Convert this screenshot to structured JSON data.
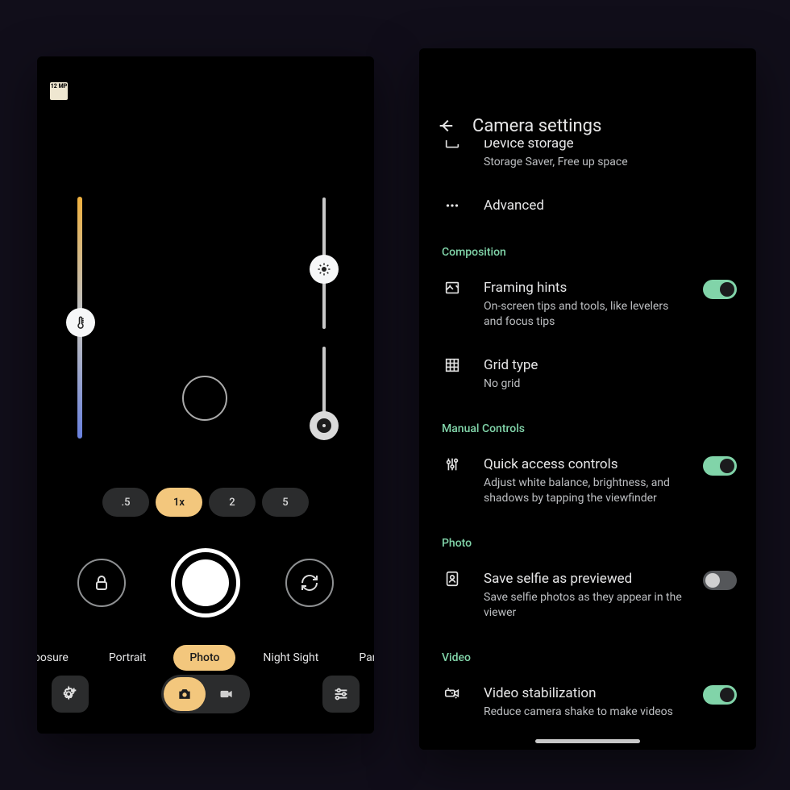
{
  "camera": {
    "res_badge": "12\nMP",
    "zoom": [
      ".5",
      "1x",
      "2",
      "5"
    ],
    "zoom_active": 1,
    "modes": [
      "g Exposure",
      "Portrait",
      "Photo",
      "Night Sight",
      "Panorar"
    ],
    "mode_active": 2
  },
  "settings": {
    "title": "Camera settings",
    "items": [
      {
        "type": "item",
        "icon": "storage",
        "title": "Device storage",
        "sub": "Storage Saver, Free up space",
        "clip": "top"
      },
      {
        "type": "item",
        "icon": "dots",
        "title": "Advanced",
        "sub": ""
      },
      {
        "type": "cat",
        "label": "Composition"
      },
      {
        "type": "toggle",
        "icon": "frame",
        "title": "Framing hints",
        "sub": "On-screen tips and tools, like levelers and focus tips",
        "on": true
      },
      {
        "type": "item",
        "icon": "grid",
        "title": "Grid type",
        "sub": "No grid"
      },
      {
        "type": "cat",
        "label": "Manual Controls"
      },
      {
        "type": "toggle",
        "icon": "sliders",
        "title": "Quick access controls",
        "sub": "Adjust white balance, brightness, and shadows by tapping the viewfinder",
        "on": true
      },
      {
        "type": "cat",
        "label": "Photo"
      },
      {
        "type": "toggle",
        "icon": "selfie",
        "title": "Save selfie as previewed",
        "sub": "Save selfie photos as they appear in the viewer",
        "on": false
      },
      {
        "type": "cat",
        "label": "Video"
      },
      {
        "type": "toggle",
        "icon": "stab",
        "title": "Video stabilization",
        "sub": "Reduce camera shake to make videos",
        "on": true
      }
    ]
  }
}
